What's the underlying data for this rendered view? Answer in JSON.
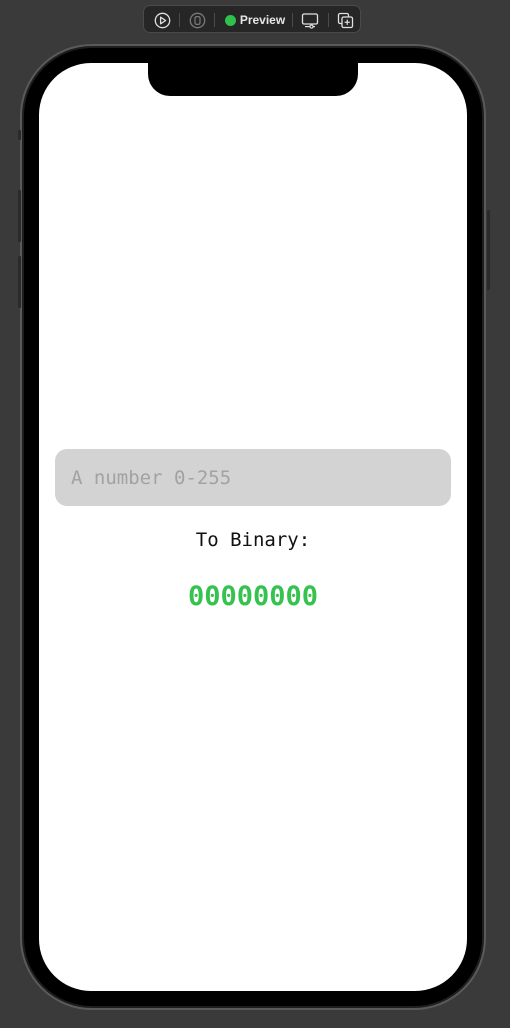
{
  "toolbar": {
    "live_icon": "play-circle-icon",
    "selectable_icon": "selectable-mode-icon",
    "preview_label": "Preview",
    "preview_status_color": "#2fc14e",
    "device_settings_icon": "device-settings-icon",
    "duplicate_icon": "duplicate-preview-icon"
  },
  "app": {
    "input_placeholder": "A number 0-255",
    "input_value": "",
    "result_label": "To Binary:",
    "result_value": "00000000",
    "result_color": "#36c24f",
    "field_background": "#d3d3d3"
  }
}
